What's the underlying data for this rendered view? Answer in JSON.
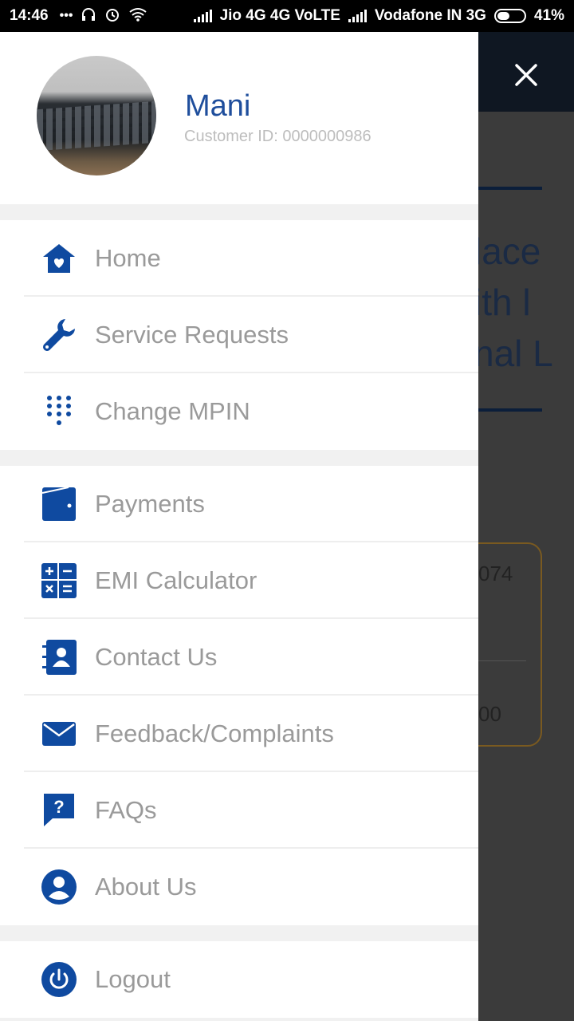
{
  "status_bar": {
    "time": "14:46",
    "carrier1": "Jio 4G 4G VoLTE",
    "carrier2": "Vodafone IN 3G",
    "battery": "41%"
  },
  "profile": {
    "name": "Mani",
    "customer_id": "Customer ID: 0000000986"
  },
  "menu": {
    "group1": [
      {
        "label": "Home",
        "icon": "home-icon"
      },
      {
        "label": "Service Requests",
        "icon": "wrench-icon"
      },
      {
        "label": "Change MPIN",
        "icon": "keypad-icon"
      }
    ],
    "group2": [
      {
        "label": "Payments",
        "icon": "wallet-icon"
      },
      {
        "label": "EMI Calculator",
        "icon": "calculator-icon"
      },
      {
        "label": "Contact Us",
        "icon": "contact-book-icon"
      },
      {
        "label": "Feedback/Complaints",
        "icon": "mail-icon"
      },
      {
        "label": "FAQs",
        "icon": "question-icon"
      },
      {
        "label": "About Us",
        "icon": "person-icon"
      }
    ],
    "group3": [
      {
        "label": "Logout",
        "icon": "power-icon"
      }
    ]
  },
  "background": {
    "text_lines": [
      "lace",
      "ith l",
      "nal L"
    ],
    "card_values": [
      "074",
      "00"
    ]
  },
  "colors": {
    "accent": "#1f4e9c",
    "icon": "#0f4aa0",
    "label": "#9a9a9a"
  }
}
